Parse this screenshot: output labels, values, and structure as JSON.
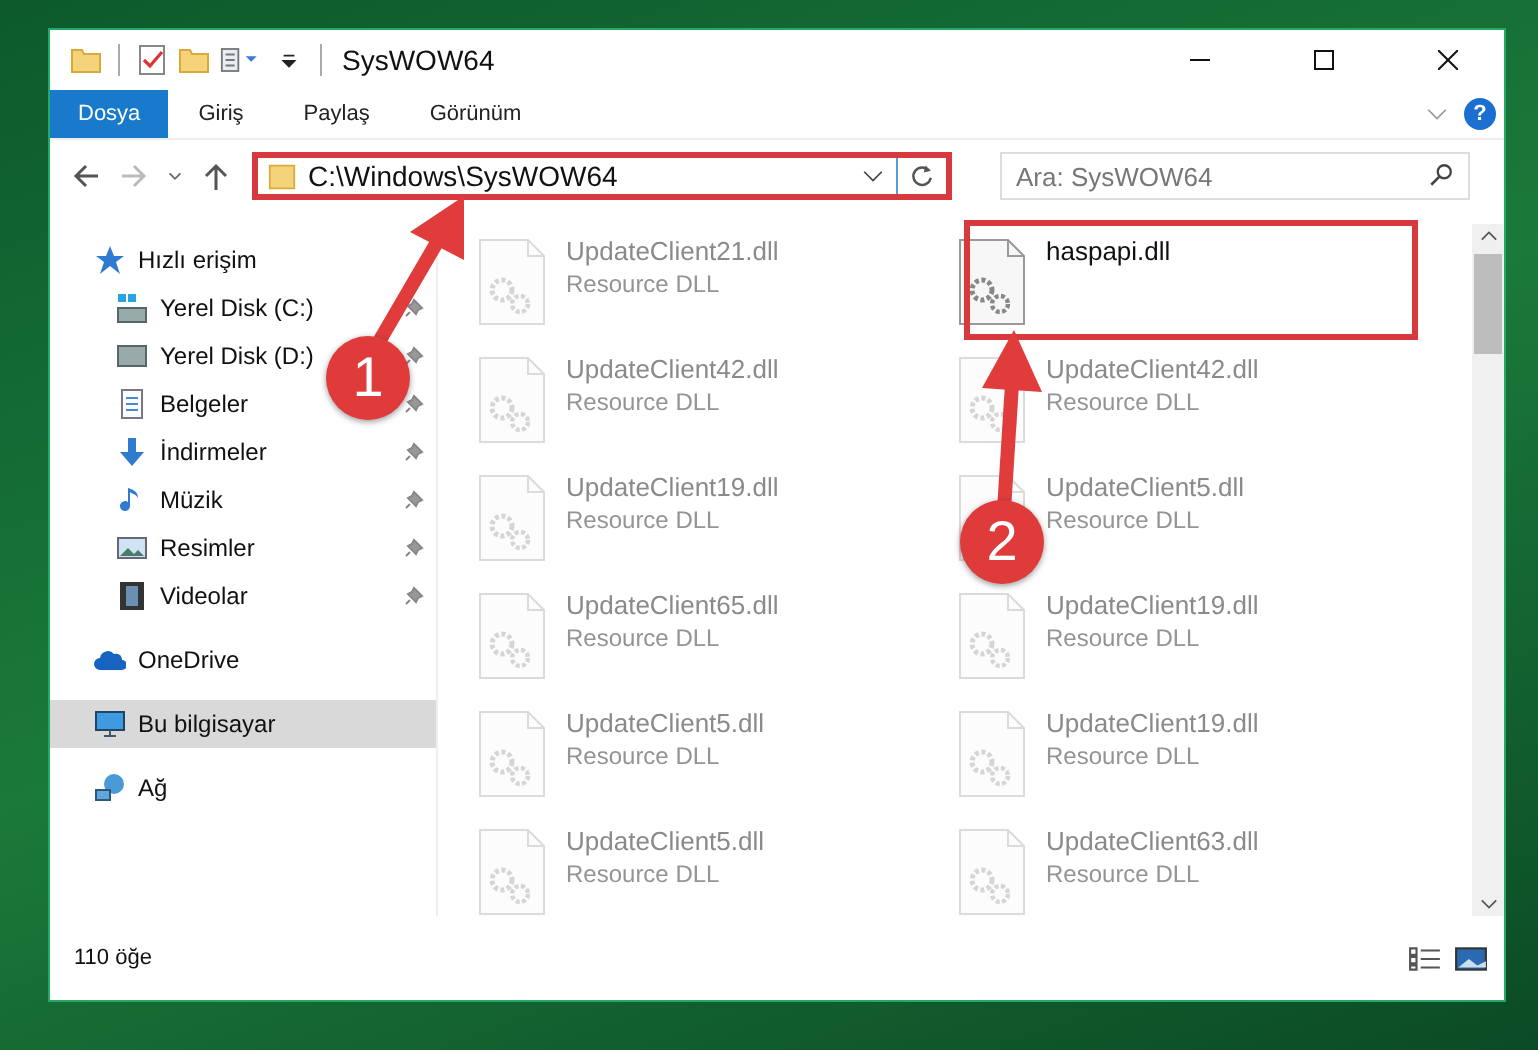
{
  "window": {
    "title": "SysWOW64"
  },
  "ribbon": {
    "tabs": [
      {
        "label": "Dosya",
        "selected": true
      },
      {
        "label": "Giriş",
        "selected": false
      },
      {
        "label": "Paylaş",
        "selected": false
      },
      {
        "label": "Görünüm",
        "selected": false
      }
    ],
    "help": "?"
  },
  "address_bar": {
    "path": "C:\\Windows\\SysWOW64"
  },
  "search": {
    "placeholder": "Ara: SysWOW64"
  },
  "navigation": [
    {
      "label": "Hızlı erişim",
      "kind": "star",
      "selected": false,
      "children": [
        {
          "label": "Yerel Disk (C:)",
          "kind": "system-drive",
          "pinned": true,
          "selected": false
        },
        {
          "label": "Yerel Disk (D:)",
          "kind": "drive",
          "pinned": true,
          "selected": false
        },
        {
          "label": "Belgeler",
          "kind": "documents",
          "pinned": true,
          "selected": false
        },
        {
          "label": "İndirmeler",
          "kind": "download",
          "pinned": true,
          "selected": false
        },
        {
          "label": "Müzik",
          "kind": "music",
          "pinned": true,
          "selected": false
        },
        {
          "label": "Resimler",
          "kind": "pictures",
          "pinned": true,
          "selected": false
        },
        {
          "label": "Videolar",
          "kind": "videos",
          "pinned": true,
          "selected": false
        }
      ]
    },
    {
      "label": "OneDrive",
      "kind": "cloud",
      "selected": false
    },
    {
      "label": "Bu bilgisayar",
      "kind": "computer",
      "selected": true
    },
    {
      "label": "Ağ",
      "kind": "network",
      "selected": false
    }
  ],
  "files": [
    {
      "name": "UpdateClient21.dll",
      "type": "Resource DLL",
      "faded": true
    },
    {
      "name": "haspapi.dll",
      "faded": false
    },
    {
      "name": "UpdateClient42.dll",
      "type": "Resource DLL",
      "faded": true
    },
    {
      "name": "UpdateClient42.dll",
      "type": "Resource DLL",
      "faded": true
    },
    {
      "name": "UpdateClient19.dll",
      "type": "Resource DLL",
      "faded": true
    },
    {
      "name": "UpdateClient5.dll",
      "type": "Resource DLL",
      "faded": true
    },
    {
      "name": "UpdateClient65.dll",
      "type": "Resource DLL",
      "faded": true
    },
    {
      "name": "UpdateClient19.dll",
      "type": "Resource DLL",
      "faded": true
    },
    {
      "name": "UpdateClient5.dll",
      "type": "Resource DLL",
      "faded": true
    },
    {
      "name": "UpdateClient19.dll",
      "type": "Resource DLL",
      "faded": true
    },
    {
      "name": "UpdateClient5.dll",
      "type": "Resource DLL",
      "faded": true
    },
    {
      "name": "UpdateClient63.dll",
      "type": "Resource DLL",
      "faded": true
    }
  ],
  "status_bar": {
    "count": "110 öğe"
  },
  "annotations": [
    {
      "number": "1"
    },
    {
      "number": "2"
    }
  ]
}
